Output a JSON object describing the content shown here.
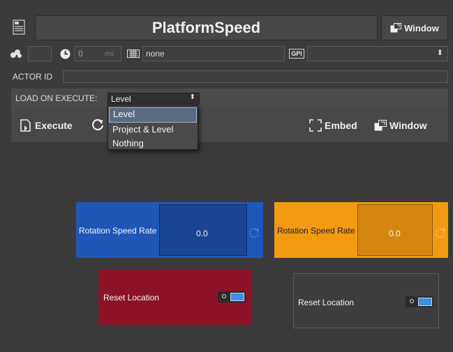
{
  "header": {
    "title": "PlatformSpeed",
    "window_label": "Window"
  },
  "row2": {
    "delay_value": "0",
    "delay_unit": "ms",
    "keyboard_value": "none",
    "gpi_label": "GPI",
    "gpi_select_value": ""
  },
  "actor": {
    "label": "ACTOR ID",
    "value": ""
  },
  "load": {
    "label": "LOAD ON EXECUTE:",
    "value": "Level",
    "options": [
      "Level",
      "Project & Level",
      "Nothing"
    ]
  },
  "toolbar": {
    "execute_label": "Execute",
    "embed_label": "Embed",
    "window_label": "Window"
  },
  "widgets": {
    "rot_blue": {
      "label": "Rotation Speed Rate",
      "value": "0.0"
    },
    "rot_orange": {
      "label": "Rotation Speed Rate",
      "value": "0.0"
    },
    "reset_red": {
      "label": "Reset Location"
    },
    "reset_gray": {
      "label": "Reset Location"
    }
  },
  "colors": {
    "blue": "#1f57b8",
    "orange": "#f29a12",
    "red": "#8c1228"
  }
}
